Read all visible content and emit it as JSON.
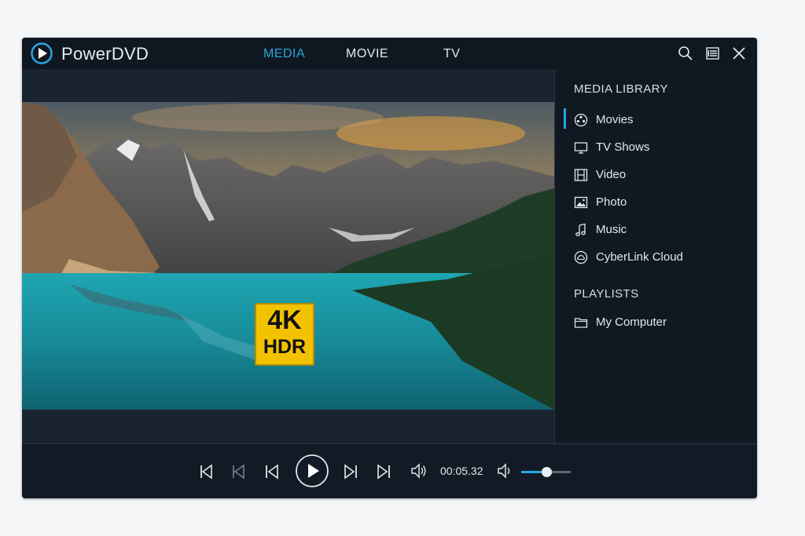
{
  "app": {
    "title": "PowerDVD"
  },
  "nav": {
    "tabs": [
      {
        "label": "MEDIA",
        "active": true
      },
      {
        "label": "MOVIE"
      },
      {
        "label": "TV"
      }
    ]
  },
  "toolbar_icons": [
    "search-icon",
    "playlist-icon",
    "close-icon"
  ],
  "video": {
    "badge_top": "4K",
    "badge_bottom": "HDR"
  },
  "sidebar": {
    "media_library_title": "MEDIA LIBRARY",
    "items": [
      {
        "label": "Movies",
        "icon": "film-reel-icon",
        "active": true
      },
      {
        "label": "TV Shows",
        "icon": "tv-icon"
      },
      {
        "label": "Video",
        "icon": "film-strip-icon"
      },
      {
        "label": "Photo",
        "icon": "image-icon"
      },
      {
        "label": "Music",
        "icon": "music-note-icon"
      },
      {
        "label": "CyberLink Cloud",
        "icon": "cloud-icon"
      }
    ],
    "playlists_title": "PLAYLISTS",
    "playlists": [
      {
        "label": "My Computer",
        "icon": "folder-icon"
      }
    ]
  },
  "playback": {
    "time": "00:05.32",
    "volume": 0.5
  },
  "colors": {
    "accent": "#2aa6e0",
    "window_bg": "#16202b",
    "badge": "#f2c200"
  }
}
